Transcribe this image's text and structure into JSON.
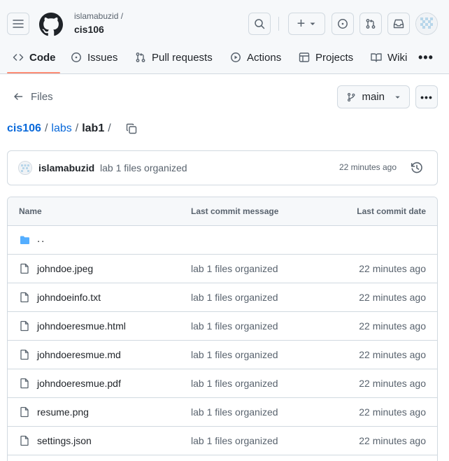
{
  "header": {
    "owner": "islamabuzid /",
    "repo": "cis106",
    "create_symbol": "+",
    "icons": [
      "menu-icon",
      "github-logo-icon",
      "search-icon",
      "plus-icon",
      "triangle-down-icon",
      "issue-opened-icon",
      "git-pull-request-icon",
      "inbox-icon",
      "avatar"
    ]
  },
  "tabs": [
    {
      "label": "Code",
      "icon": "code-icon",
      "active": true
    },
    {
      "label": "Issues",
      "icon": "issue-opened-icon"
    },
    {
      "label": "Pull requests",
      "icon": "git-pull-request-icon"
    },
    {
      "label": "Actions",
      "icon": "play-icon"
    },
    {
      "label": "Projects",
      "icon": "table-icon"
    },
    {
      "label": "Wiki",
      "icon": "book-icon"
    }
  ],
  "tabs_more": "•••",
  "files_bar": {
    "files_label": "Files",
    "branch": "main",
    "more": "•••"
  },
  "breadcrumb": {
    "root": "cis106",
    "sep1": "/",
    "folder": "labs",
    "sep2": "/",
    "current": "lab1",
    "sep3": "/"
  },
  "commit": {
    "author": "islamabuzid",
    "message": "lab 1 files organized",
    "time": "22 minutes ago"
  },
  "table": {
    "headers": {
      "name": "Name",
      "message": "Last commit message",
      "date": "Last commit date"
    },
    "parent_dir": "..",
    "rows": [
      {
        "name": "johndoe.jpeg",
        "message": "lab 1 files organized",
        "date": "22 minutes ago"
      },
      {
        "name": "johndoeinfo.txt",
        "message": "lab 1 files organized",
        "date": "22 minutes ago"
      },
      {
        "name": "johndoeresmue.html",
        "message": "lab 1 files organized",
        "date": "22 minutes ago"
      },
      {
        "name": "johndoeresmue.md",
        "message": "lab 1 files organized",
        "date": "22 minutes ago"
      },
      {
        "name": "johndoeresmue.pdf",
        "message": "lab 1 files organized",
        "date": "22 minutes ago"
      },
      {
        "name": "resume.png",
        "message": "lab 1 files organized",
        "date": "22 minutes ago"
      },
      {
        "name": "settings.json",
        "message": "lab 1 files organized",
        "date": "22 minutes ago"
      }
    ]
  },
  "colors": {
    "link": "#0969da",
    "folder": "#54aeff",
    "tab_underline": "#fd8c73",
    "border": "#d1d9e0",
    "muted": "#59636e"
  }
}
